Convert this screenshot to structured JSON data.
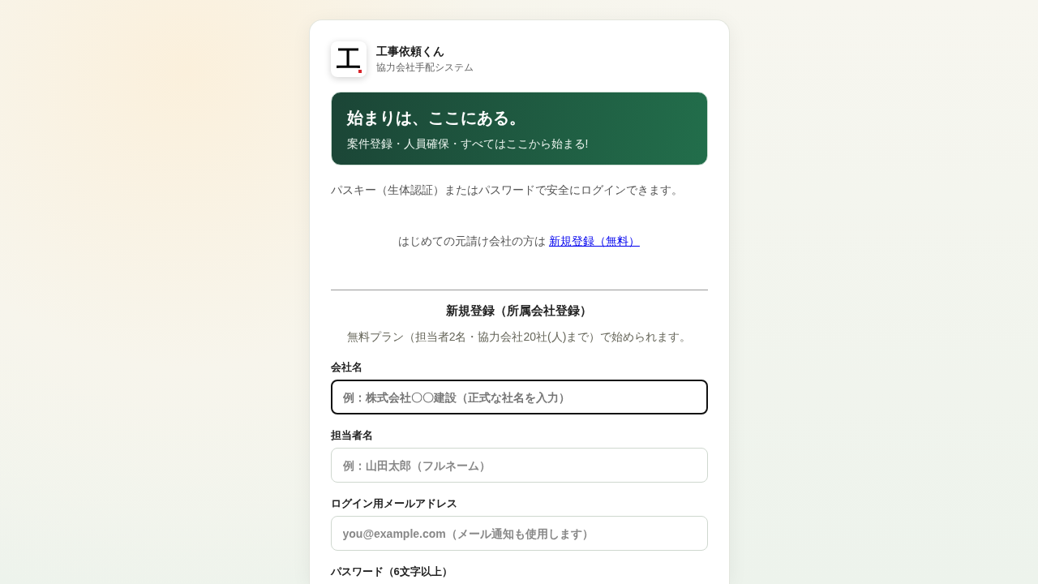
{
  "app": {
    "logo_mark": "工",
    "title": "工事依頼くん",
    "subtitle": "協力会社手配システム"
  },
  "hero": {
    "heading": "始まりは、ここにある。",
    "tagline": "案件登録・人員確保・すべてはここから始まる!"
  },
  "intro": "パスキー（生体認証）またはパスワードで安全にログインできます。",
  "signup_prompt": {
    "text": "はじめての元請け会社の方は",
    "link": "新規登録（無料）"
  },
  "registration": {
    "title": "新規登録（所属会社登録）",
    "note": "無料プラン（担当者2名・協力会社20社(人)まで）で始められます。",
    "fields": [
      {
        "label": "会社名",
        "placeholder": "例：株式会社〇〇建設（正式な社名を入力）",
        "focused": true
      },
      {
        "label": "担当者名",
        "placeholder": "例：山田太郎（フルネーム）",
        "focused": false
      },
      {
        "label": "ログイン用メールアドレス",
        "placeholder": "you@example.com（メール通知も使用します）",
        "focused": false
      },
      {
        "label": "パスワード（6文字以上）"
      }
    ]
  }
}
